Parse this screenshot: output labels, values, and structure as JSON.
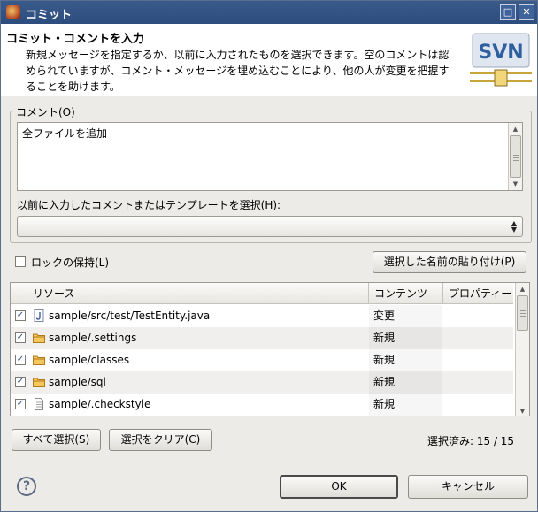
{
  "window": {
    "title": "コミット",
    "maximize_glyph": "□",
    "close_glyph": "✕"
  },
  "header": {
    "title": "コミット・コメントを入力",
    "description": "新規メッセージを指定するか、以前に入力されたものを選択できます。空のコメントは認められていますが、コメント・メッセージを埋め込むことにより、他の人が変更を把握することを助けます。",
    "logo_text": "SVN"
  },
  "comment": {
    "group_label": "コメント(O)",
    "text": "全ファイルを追加",
    "previous_label": "以前に入力したコメントまたはテンプレートを選択(H):",
    "previous_selected": ""
  },
  "lock": {
    "label": "ロックの保持(L)",
    "checked": false
  },
  "paste_button": "選択した名前の貼り付け(P)",
  "table": {
    "columns": [
      "リソース",
      "コンテンツ",
      "プロパティー"
    ],
    "rows": [
      {
        "checked": true,
        "icon": "java-file-icon",
        "resource": "sample/src/test/TestEntity.java",
        "contents": "変更",
        "properties": ""
      },
      {
        "checked": true,
        "icon": "folder-icon",
        "resource": "sample/.settings",
        "contents": "新規",
        "properties": ""
      },
      {
        "checked": true,
        "icon": "folder-icon",
        "resource": "sample/classes",
        "contents": "新規",
        "properties": ""
      },
      {
        "checked": true,
        "icon": "folder-icon",
        "resource": "sample/sql",
        "contents": "新規",
        "properties": ""
      },
      {
        "checked": true,
        "icon": "text-file-icon",
        "resource": "sample/.checkstyle",
        "contents": "新規",
        "properties": ""
      }
    ]
  },
  "select_all_button": "すべて選択(S)",
  "clear_selection_button": "選択をクリア(C)",
  "selection_status": "選択済み: 15 / 15",
  "ok_button": "OK",
  "cancel_button": "キャンセル",
  "help_glyph": "?",
  "check_glyph": "✓",
  "colors": {
    "titlebar": "#2d4d7e",
    "folder": "#e8a93a",
    "svn_logo": "#2f5f9e"
  }
}
